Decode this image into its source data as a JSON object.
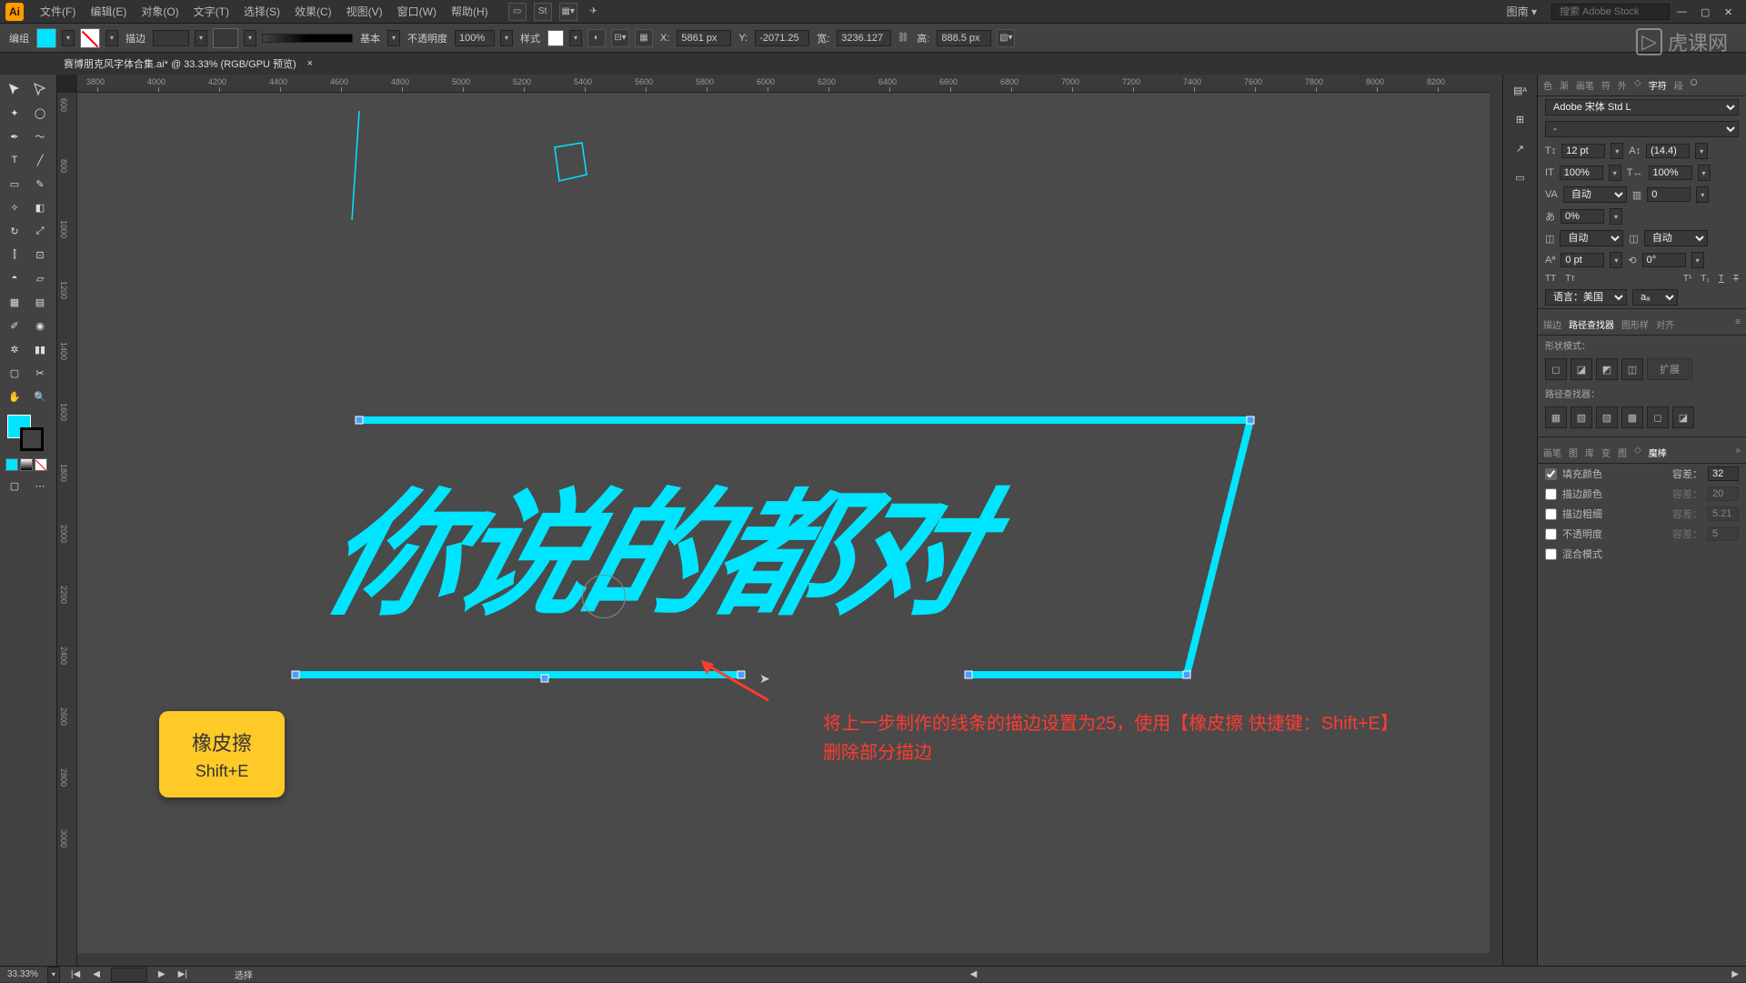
{
  "menu": {
    "file": "文件(F)",
    "edit": "编辑(E)",
    "object": "对象(O)",
    "type": "文字(T)",
    "select": "选择(S)",
    "effect": "效果(C)",
    "view": "视图(V)",
    "window": "窗口(W)",
    "help": "帮助(H)"
  },
  "topright": {
    "layout": "图南",
    "search_ph": "搜索 Adobe Stock"
  },
  "control": {
    "mode": "编组",
    "stroke_label": "描边",
    "stroke_opts": "",
    "profile": "基本",
    "opacity_label": "不透明度",
    "opacity": "100%",
    "style_label": "样式",
    "x_label": "X:",
    "x": "5861 px",
    "y_label": "Y:",
    "y": "-2071.25",
    "w_label": "宽:",
    "w": "3236.127",
    "h_label": "高:",
    "h": "888.5 px"
  },
  "doc": {
    "title": "赛博朋克风字体合集.ai* @ 33.33% (RGB/GPU 预览)"
  },
  "ruler_h": [
    "3800",
    "4000",
    "4200",
    "4400",
    "4600",
    "4800",
    "5000",
    "5200",
    "5400",
    "5600",
    "5800",
    "6000",
    "6200",
    "6400",
    "6600",
    "6800",
    "7000",
    "7200",
    "7400",
    "7600",
    "7800",
    "8000",
    "8200"
  ],
  "ruler_v": [
    "600",
    "800",
    "1000",
    "1200",
    "1400",
    "1600",
    "1800",
    "2000",
    "2200",
    "2400",
    "2600",
    "2800",
    "3000"
  ],
  "artwork_text": "你说的都对",
  "tooltip": {
    "title": "橡皮擦",
    "shortcut": "Shift+E"
  },
  "annotation": {
    "line1": "将上一步制作的线条的描边设置为25，使用【橡皮擦 快捷键：Shift+E】",
    "line2": "删除部分描边"
  },
  "char_panel": {
    "tabs": [
      "色",
      "渐",
      "画笔",
      "符",
      "外",
      "字符",
      "段",
      "O"
    ],
    "font": "Adobe 宋体 Std L",
    "size": "12 pt",
    "leading": "(14.4)",
    "hscale": "100%",
    "vscale": "100%",
    "kerning": "自动",
    "tracking": "0",
    "baseline": "0%",
    "rotate": "自动",
    "skew": "自动",
    "shift": "0 pt",
    "angle": "0°",
    "lang": "语言：美国",
    "aa": "aₐ"
  },
  "pathfinder": {
    "tabs": [
      "描边",
      "路径查找器",
      "图形样",
      "对齐"
    ],
    "shape_label": "形状模式：",
    "path_label": "路径查找器：",
    "expand": "扩展"
  },
  "magic": {
    "tabs": [
      "画笔",
      "图",
      "库",
      "变",
      "图",
      "魔棒"
    ],
    "fill": "填充颜色",
    "stroke_color": "描边颜色",
    "stroke_weight": "描边粗细",
    "opacity": "不透明度",
    "blend": "混合模式",
    "tolerance_label": "容差：",
    "tolerance": "32",
    "s_tol": "20",
    "sw_tol": "5.21",
    "op_tol": "5"
  },
  "status": {
    "zoom": "33.33%",
    "select": "选择"
  },
  "watermark": "虎课网"
}
